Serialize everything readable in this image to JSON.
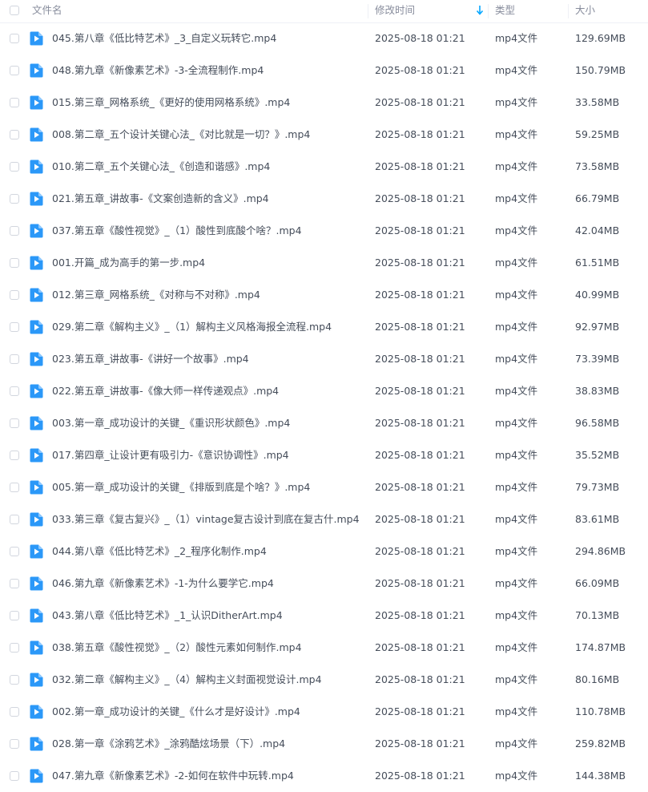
{
  "header": {
    "name_label": "文件名",
    "modified_label": "修改时间",
    "type_label": "类型",
    "size_label": "大小"
  },
  "colors": {
    "accent": "#06a7ff",
    "header_text": "#878c9c",
    "row_text": "#454d5a"
  },
  "files": [
    {
      "name": "045.第八章《低比特艺术》_3_自定义玩转它.mp4",
      "modified": "2025-08-18 01:21",
      "type": "mp4文件",
      "size": "129.69MB"
    },
    {
      "name": "048.第九章《新像素艺术》-3-全流程制作.mp4",
      "modified": "2025-08-18 01:21",
      "type": "mp4文件",
      "size": "150.79MB"
    },
    {
      "name": "015.第三章_网格系统_《更好的使用网格系统》.mp4",
      "modified": "2025-08-18 01:21",
      "type": "mp4文件",
      "size": "33.58MB"
    },
    {
      "name": "008.第二章_五个设计关键心法_《对比就是一切？》.mp4",
      "modified": "2025-08-18 01:21",
      "type": "mp4文件",
      "size": "59.25MB"
    },
    {
      "name": "010.第二章_五个关键心法_《创造和谐感》.mp4",
      "modified": "2025-08-18 01:21",
      "type": "mp4文件",
      "size": "73.58MB"
    },
    {
      "name": "021.第五章_讲故事-《文案创造新的含义》.mp4",
      "modified": "2025-08-18 01:21",
      "type": "mp4文件",
      "size": "66.79MB"
    },
    {
      "name": "037.第五章《酸性视觉》_（1）酸性到底酸个啥？.mp4",
      "modified": "2025-08-18 01:21",
      "type": "mp4文件",
      "size": "42.04MB"
    },
    {
      "name": "001.开篇_成为高手的第一步.mp4",
      "modified": "2025-08-18 01:21",
      "type": "mp4文件",
      "size": "61.51MB"
    },
    {
      "name": "012.第三章_网格系统_《对称与不对称》.mp4",
      "modified": "2025-08-18 01:21",
      "type": "mp4文件",
      "size": "40.99MB"
    },
    {
      "name": "029.第二章《解构主义》_（1）解构主义风格海报全流程.mp4",
      "modified": "2025-08-18 01:21",
      "type": "mp4文件",
      "size": "92.97MB"
    },
    {
      "name": "023.第五章_讲故事-《讲好一个故事》.mp4",
      "modified": "2025-08-18 01:21",
      "type": "mp4文件",
      "size": "73.39MB"
    },
    {
      "name": "022.第五章_讲故事-《像大师一样传递观点》.mp4",
      "modified": "2025-08-18 01:21",
      "type": "mp4文件",
      "size": "38.83MB"
    },
    {
      "name": "003.第一章_成功设计的关键_《重识形状颜色》.mp4",
      "modified": "2025-08-18 01:21",
      "type": "mp4文件",
      "size": "96.58MB"
    },
    {
      "name": "017.第四章_让设计更有吸引力-《意识协调性》.mp4",
      "modified": "2025-08-18 01:21",
      "type": "mp4文件",
      "size": "35.52MB"
    },
    {
      "name": "005.第一章_成功设计的关键_《排版到底是个啥？》.mp4",
      "modified": "2025-08-18 01:21",
      "type": "mp4文件",
      "size": "79.73MB"
    },
    {
      "name": "033.第三章《复古复兴》_（1）vintage复古设计到底在复古什.mp4",
      "modified": "2025-08-18 01:21",
      "type": "mp4文件",
      "size": "83.61MB"
    },
    {
      "name": "044.第八章《低比特艺术》_2_程序化制作.mp4",
      "modified": "2025-08-18 01:21",
      "type": "mp4文件",
      "size": "294.86MB"
    },
    {
      "name": "046.第九章《新像素艺术》-1-为什么要学它.mp4",
      "modified": "2025-08-18 01:21",
      "type": "mp4文件",
      "size": "66.09MB"
    },
    {
      "name": "043.第八章《低比特艺术》_1_认识DitherArt.mp4",
      "modified": "2025-08-18 01:21",
      "type": "mp4文件",
      "size": "70.13MB"
    },
    {
      "name": "038.第五章《酸性视觉》_（2）酸性元素如何制作.mp4",
      "modified": "2025-08-18 01:21",
      "type": "mp4文件",
      "size": "174.87MB"
    },
    {
      "name": "032.第二章《解构主义》_（4）解构主义封面视觉设计.mp4",
      "modified": "2025-08-18 01:21",
      "type": "mp4文件",
      "size": "80.16MB"
    },
    {
      "name": "002.第一章_成功设计的关键_《什么才是好设计》.mp4",
      "modified": "2025-08-18 01:21",
      "type": "mp4文件",
      "size": "110.78MB"
    },
    {
      "name": "028.第一章《涂鸦艺术》_涂鸦酷炫场景（下）.mp4",
      "modified": "2025-08-18 01:21",
      "type": "mp4文件",
      "size": "259.82MB"
    },
    {
      "name": "047.第九章《新像素艺术》-2-如何在软件中玩转.mp4",
      "modified": "2025-08-18 01:21",
      "type": "mp4文件",
      "size": "144.38MB"
    }
  ]
}
